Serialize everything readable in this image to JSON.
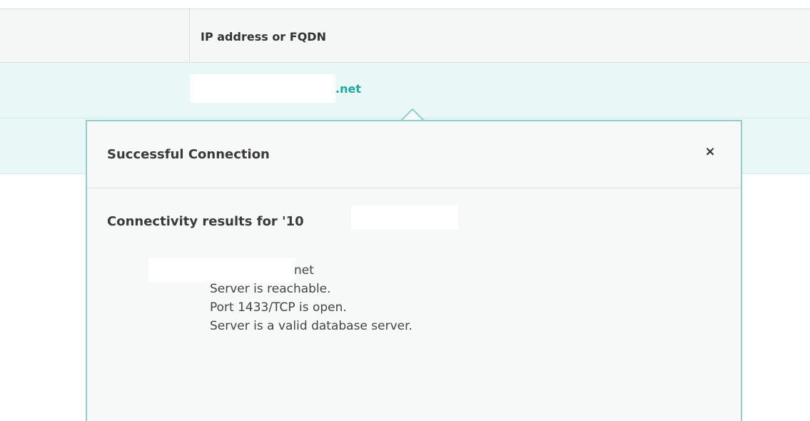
{
  "table": {
    "header": {
      "column_fqdn": "IP address or FQDN"
    },
    "rows": [
      {
        "fqdn_suffix": ".net"
      }
    ]
  },
  "popover": {
    "title": "Successful Connection",
    "close_icon": "close-icon",
    "close_glyph": "×",
    "results_heading": "Connectivity results for '10",
    "host_suffix": "net",
    "results": [
      "Server is reachable.",
      "Port 1433/TCP is open.",
      "Server is a valid database server."
    ]
  },
  "colors": {
    "accent": "#1aaaa0",
    "row_highlight": "#e9f7f7",
    "popover_border": "#8ecfc9"
  }
}
